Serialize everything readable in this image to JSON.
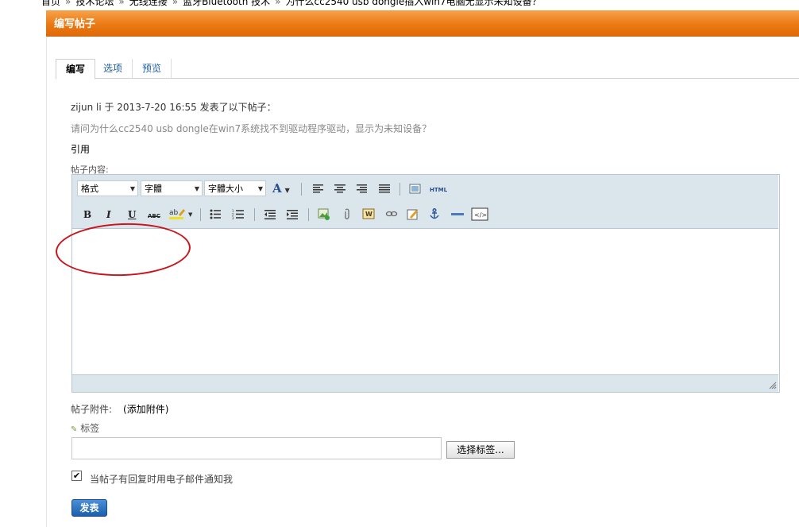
{
  "breadcrumb": [
    "首页",
    "技术论坛",
    "无线连接",
    "蓝牙Bluetooth 技术",
    "为什么cc2540 usb dongle插入win7电脑无显示未知设备？"
  ],
  "header": {
    "title": "编写帖子"
  },
  "tabs": [
    {
      "label": "编写",
      "active": true
    },
    {
      "label": "选项",
      "active": false
    },
    {
      "label": "预览",
      "active": false
    }
  ],
  "post": {
    "info": "zijun li 于 2013-7-20 16:55 发表了以下帖子：",
    "quoted_question": "请问为什么cc2540 usb dongle在win7系统找不到驱动程序驱动，显示为未知设备？",
    "cite_label": "引用",
    "content_label": "帖子内容:"
  },
  "editor": {
    "format_select": "格式",
    "font_select": "字體",
    "size_select": "字體大小",
    "font_color": "A",
    "html_label": "HTML",
    "bold": "B",
    "italic": "I",
    "underline": "U",
    "strike": "ABC"
  },
  "attachments": {
    "label": "帖子附件:",
    "add": "(添加附件)"
  },
  "tags": {
    "label": "标签",
    "value": "",
    "choose_button": "选择标签..."
  },
  "notify": {
    "checked": true,
    "label": "当帖子有回复时用电子邮件通知我"
  },
  "submit": {
    "label": "发表"
  }
}
